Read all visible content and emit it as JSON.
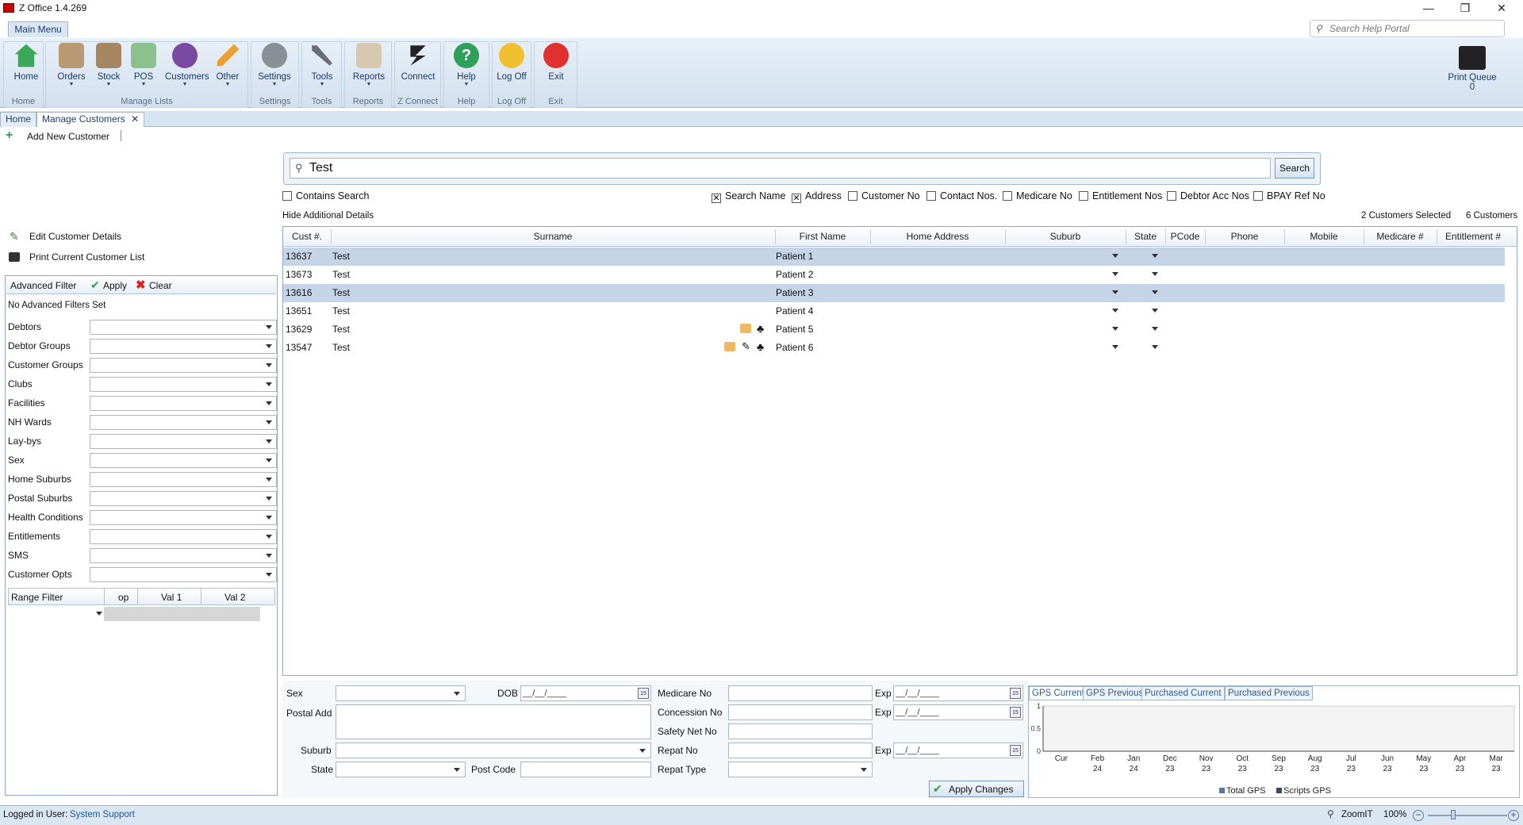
{
  "window": {
    "title": "Z Office 1.4.269",
    "min": "—",
    "max": "❐",
    "close": "✕"
  },
  "help_search": {
    "placeholder": "Search Help Portal"
  },
  "ribbon": {
    "menu_tab": "Main Menu",
    "buttons": {
      "home": "Home",
      "orders": "Orders",
      "stock": "Stock",
      "pos": "POS",
      "customers": "Customers",
      "other": "Other",
      "settings": "Settings",
      "tools": "Tools",
      "reports": "Reports",
      "connect": "Connect",
      "help": "Help",
      "logoff": "Log Off",
      "exit": "Exit"
    },
    "groups": {
      "home": "Home",
      "manage_lists": "Manage Lists",
      "settings": "Settings",
      "tools": "Tools",
      "reports": "Reports",
      "zconnect": "Z Connect",
      "help": "Help",
      "logoff": "Log Off",
      "exit": "Exit"
    },
    "print_queue": {
      "label": "Print Queue",
      "count": "0"
    }
  },
  "tabs": {
    "home": "Home",
    "manage": "Manage Customers",
    "close": "✕"
  },
  "toolbar": {
    "add_customer": "Add New Customer"
  },
  "search": {
    "value": "Test",
    "button": "Search",
    "contains": "Contains Search",
    "options": [
      {
        "label": "Search Name",
        "checked": "✕"
      },
      {
        "label": "Address",
        "checked": "✕"
      },
      {
        "label": "Customer No",
        "checked": ""
      },
      {
        "label": "Contact Nos.",
        "checked": ""
      },
      {
        "label": "Medicare No",
        "checked": ""
      },
      {
        "label": "Entitlement Nos",
        "checked": ""
      },
      {
        "label": "Debtor Acc Nos",
        "checked": ""
      },
      {
        "label": "BPAY Ref No",
        "checked": ""
      }
    ],
    "hide_details": "Hide Additional Details",
    "selected_count": "2 Customers Selected",
    "total_count": "6 Customers"
  },
  "grid": {
    "columns": [
      "Cust #.",
      "Surname",
      "First Name",
      "Home Address",
      "Suburb",
      "State",
      "PCode",
      "Phone",
      "Mobile",
      "Medicare #",
      "Entitlement #"
    ],
    "rows": [
      {
        "id": "13637",
        "surname": "Test",
        "first": "Patient 1"
      },
      {
        "id": "13673",
        "surname": "Test",
        "first": "Patient 2"
      },
      {
        "id": "13616",
        "surname": "Test",
        "first": "Patient 3"
      },
      {
        "id": "13651",
        "surname": "Test",
        "first": "Patient 4"
      },
      {
        "id": "13629",
        "surname": "Test",
        "first": "Patient 5"
      },
      {
        "id": "13547",
        "surname": "Test",
        "first": "Patient 6"
      }
    ]
  },
  "left": {
    "edit": "Edit Customer Details",
    "print": "Print Current Customer List",
    "adv_filter": "Advanced Filter",
    "apply": "Apply",
    "clear": "Clear",
    "no_filters": "No Advanced Filters Set",
    "filters": [
      "Debtors",
      "Debtor Groups",
      "Customer Groups",
      "Clubs",
      "Facilities",
      "NH Wards",
      "Lay-bys",
      "Sex",
      "Home Suburbs",
      "Postal Suburbs",
      "Health Conditions",
      "Entitlements",
      "SMS",
      "Customer Opts"
    ],
    "range": {
      "filter": "Range Filter",
      "op": "op",
      "val1": "Val 1",
      "val2": "Val 2"
    }
  },
  "details": {
    "sex": "Sex",
    "dob": "DOB",
    "dob_value": "__/__/____",
    "postal_add": "Postal Add",
    "suburb": "Suburb",
    "state": "State",
    "post_code": "Post Code",
    "medicare_no": "Medicare No",
    "concession_no": "Concession No",
    "safety_net_no": "Safety Net No",
    "repat_no": "Repat No",
    "repat_type": "Repat Type",
    "exp": "Exp",
    "exp_value": "__/__/____",
    "apply_changes": "Apply Changes"
  },
  "chart_tabs": [
    "GPS Current",
    "GPS Previous",
    "Purchased Current",
    "Purchased Previous"
  ],
  "chart_data": {
    "type": "bar",
    "categories": [
      "Cur",
      "Feb 24",
      "Jan 24",
      "Dec 23",
      "Nov 23",
      "Oct 23",
      "Sep 23",
      "Aug 23",
      "Jul 23",
      "Jun 23",
      "May 23",
      "Apr 23",
      "Mar 23"
    ],
    "category_lines": [
      [
        "Cur",
        ""
      ],
      [
        "Feb",
        "24"
      ],
      [
        "Jan",
        "24"
      ],
      [
        "Dec",
        "23"
      ],
      [
        "Nov",
        "23"
      ],
      [
        "Oct",
        "23"
      ],
      [
        "Sep",
        "23"
      ],
      [
        "Aug",
        "23"
      ],
      [
        "Jul",
        "23"
      ],
      [
        "Jun",
        "23"
      ],
      [
        "May",
        "23"
      ],
      [
        "Apr",
        "23"
      ],
      [
        "Mar",
        "23"
      ]
    ],
    "series": [
      {
        "name": "Total GPS",
        "values": [
          0,
          0,
          0,
          0,
          0,
          0,
          0,
          0,
          0,
          0,
          0,
          0,
          0
        ],
        "color": "#4a7ab0"
      },
      {
        "name": "Scripts GPS",
        "values": [
          0,
          0,
          0,
          0,
          0,
          0,
          0,
          0,
          0,
          0,
          0,
          0,
          0
        ],
        "color": "#2e4a6a"
      }
    ],
    "ylim": [
      0,
      1
    ],
    "yticks": [
      "0",
      "0.5",
      "1"
    ],
    "legend": "bottom"
  },
  "status": {
    "logged_label": "Logged in User:",
    "user": "System Support",
    "zoom_label": "ZoomIT",
    "zoom": "100%"
  }
}
